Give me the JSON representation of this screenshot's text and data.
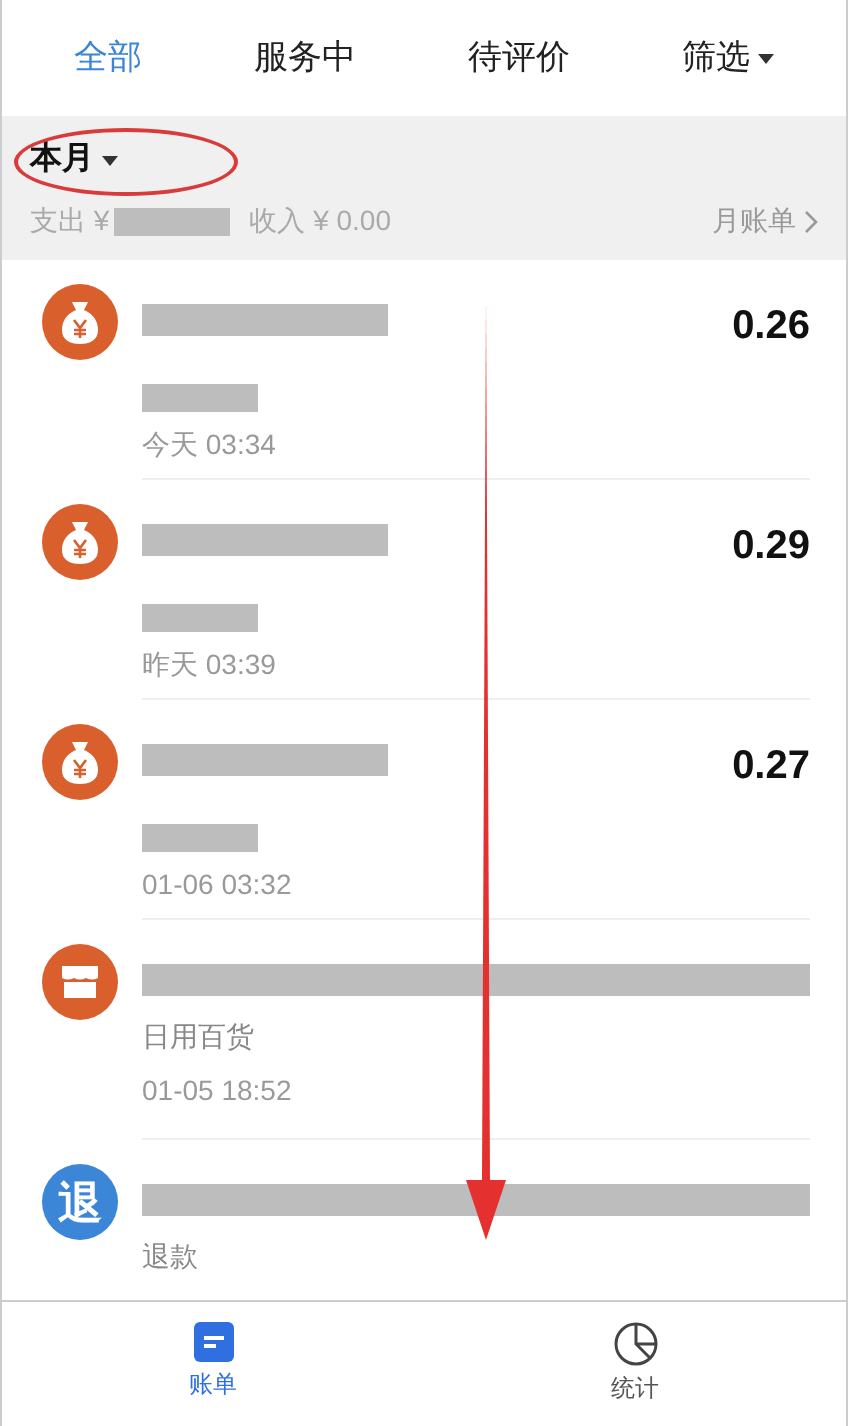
{
  "tabs": [
    {
      "label": "全部",
      "selected": true
    },
    {
      "label": "服务中",
      "selected": false
    },
    {
      "label": "待评价",
      "selected": false
    },
    {
      "label": "筛选",
      "selected": false,
      "dropdown": true
    }
  ],
  "summary": {
    "period": "本月",
    "expense_label": "支出 ¥",
    "expense_redacted": true,
    "income": "收入 ¥ 0.00",
    "monthly_bill": "月账单"
  },
  "records": [
    {
      "kind": "money",
      "title_redacted": true,
      "category_redacted": true,
      "time": "今天  03:34",
      "amount": "0.26"
    },
    {
      "kind": "money",
      "title_redacted": true,
      "category_redacted": true,
      "time": "昨天  03:39",
      "amount": "0.29"
    },
    {
      "kind": "money",
      "title_redacted": true,
      "category_redacted": true,
      "time": "01-06  03:32",
      "amount": "0.27"
    },
    {
      "kind": "shop",
      "title_redacted": true,
      "category_redacted": false,
      "category": "日用百货",
      "time": "01-05  18:52"
    },
    {
      "kind": "refund",
      "icon_text": "退",
      "title_redacted": true,
      "category_redacted": false,
      "category": "退款"
    }
  ],
  "bottom_nav": [
    {
      "label": "账单",
      "kind": "bill",
      "selected": true
    },
    {
      "label": "统计",
      "kind": "stats",
      "selected": false
    }
  ],
  "annotations": {
    "period_circled": true,
    "down_arrow": true
  }
}
